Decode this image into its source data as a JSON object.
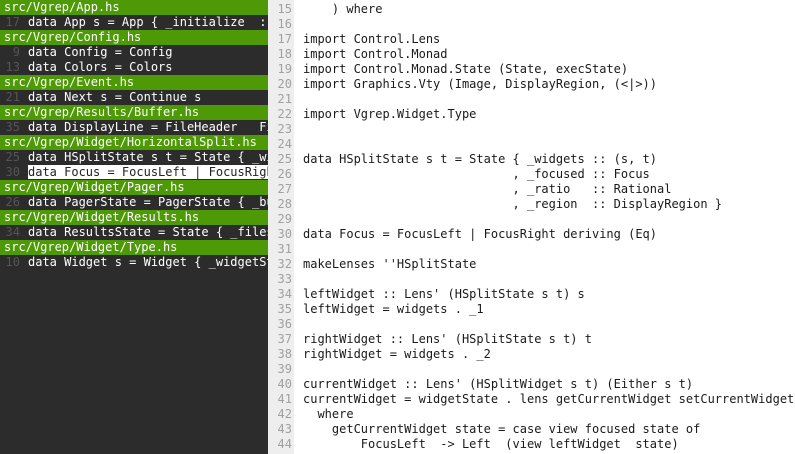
{
  "results": [
    {
      "kind": "file",
      "text": "src/Vgrep/App.hs"
    },
    {
      "kind": "match",
      "line": "17",
      "text": "data App s = App { _initialize  :: s"
    },
    {
      "kind": "file",
      "text": "src/Vgrep/Config.hs"
    },
    {
      "kind": "match",
      "line": "9",
      "text": "data Config = Config"
    },
    {
      "kind": "match",
      "line": "13",
      "text": "data Colors = Colors"
    },
    {
      "kind": "file",
      "text": "src/Vgrep/Event.hs"
    },
    {
      "kind": "match",
      "line": "21",
      "text": "data Next s = Continue s"
    },
    {
      "kind": "file",
      "text": "src/Vgrep/Results/Buffer.hs"
    },
    {
      "kind": "match",
      "line": "35",
      "text": "data DisplayLine = FileHeader   File"
    },
    {
      "kind": "file",
      "text": "src/Vgrep/Widget/HorizontalSplit.hs"
    },
    {
      "kind": "match",
      "line": "25",
      "text": "data HSplitState s t = State { _widg"
    },
    {
      "kind": "match",
      "line": "30",
      "text": "data Focus = FocusLeft | FocusRight",
      "selected": true
    },
    {
      "kind": "file",
      "text": "src/Vgrep/Widget/Pager.hs"
    },
    {
      "kind": "match",
      "line": "26",
      "text": "data PagerState = PagerState { _buff"
    },
    {
      "kind": "file",
      "text": "src/Vgrep/Widget/Results.hs"
    },
    {
      "kind": "match",
      "line": "34",
      "text": "data ResultsState = State { _files"
    },
    {
      "kind": "file",
      "text": "src/Vgrep/Widget/Type.hs"
    },
    {
      "kind": "match",
      "line": "10",
      "text": "data Widget s = Widget { _widgetSta"
    }
  ],
  "pager": {
    "lines": [
      {
        "n": "15",
        "code": "    ) where"
      },
      {
        "n": "16",
        "code": ""
      },
      {
        "n": "17",
        "code": "import Control.Lens"
      },
      {
        "n": "18",
        "code": "import Control.Monad"
      },
      {
        "n": "19",
        "code": "import Control.Monad.State (State, execState)"
      },
      {
        "n": "20",
        "code": "import Graphics.Vty (Image, DisplayRegion, (<|>))"
      },
      {
        "n": "21",
        "code": ""
      },
      {
        "n": "22",
        "code": "import Vgrep.Widget.Type"
      },
      {
        "n": "23",
        "code": ""
      },
      {
        "n": "24",
        "code": ""
      },
      {
        "n": "25",
        "code": "data HSplitState s t = State { _widgets :: (s, t)"
      },
      {
        "n": "26",
        "code": "                             , _focused :: Focus"
      },
      {
        "n": "27",
        "code": "                             , _ratio   :: Rational"
      },
      {
        "n": "28",
        "code": "                             , _region  :: DisplayRegion }"
      },
      {
        "n": "29",
        "code": ""
      },
      {
        "n": "30",
        "code": "data Focus = FocusLeft | FocusRight deriving (Eq)"
      },
      {
        "n": "31",
        "code": ""
      },
      {
        "n": "32",
        "code": "makeLenses ''HSplitState"
      },
      {
        "n": "33",
        "code": ""
      },
      {
        "n": "34",
        "code": "leftWidget :: Lens' (HSplitState s t) s"
      },
      {
        "n": "35",
        "code": "leftWidget = widgets . _1"
      },
      {
        "n": "36",
        "code": ""
      },
      {
        "n": "37",
        "code": "rightWidget :: Lens' (HSplitState s t) t"
      },
      {
        "n": "38",
        "code": "rightWidget = widgets . _2"
      },
      {
        "n": "39",
        "code": ""
      },
      {
        "n": "40",
        "code": "currentWidget :: Lens' (HSplitWidget s t) (Either s t)"
      },
      {
        "n": "41",
        "code": "currentWidget = widgetState . lens getCurrentWidget setCurrentWidget"
      },
      {
        "n": "42",
        "code": "  where"
      },
      {
        "n": "43",
        "code": "    getCurrentWidget state = case view focused state of"
      },
      {
        "n": "44",
        "code": "        FocusLeft  -> Left  (view leftWidget  state)"
      }
    ]
  },
  "colors": {
    "file_header": "#4e9a06",
    "left_bg": "#2c2c2c",
    "gutter": "#eeeeee"
  }
}
